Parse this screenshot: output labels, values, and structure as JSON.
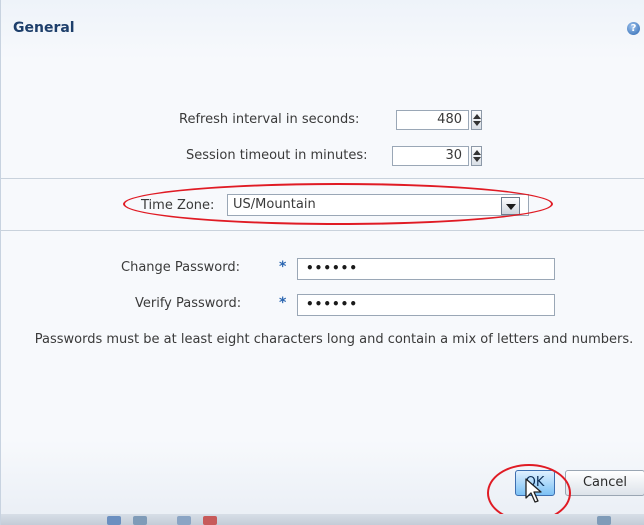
{
  "dialog": {
    "title": "General",
    "help_icon": "help-icon",
    "help_glyph": "?"
  },
  "settings": {
    "refresh_label": "Refresh interval in seconds:",
    "refresh_value": "480",
    "session_label": "Session timeout in minutes:",
    "session_value": "30",
    "timezone_label": "Time Zone:",
    "timezone_value": "US/Mountain"
  },
  "password": {
    "change_label": "Change Password:",
    "change_value": "••••••",
    "verify_label": "Verify Password:",
    "verify_value": "••••••",
    "required_marker": "*",
    "hint": "Passwords must be at least eight characters long and contain a mix of letters and numbers."
  },
  "buttons": {
    "ok": "OK",
    "cancel": "Cancel"
  },
  "colors": {
    "highlight_annotation": "#e01b24",
    "title": "#1e3f6b",
    "ok_button": "#7cc1f5"
  }
}
